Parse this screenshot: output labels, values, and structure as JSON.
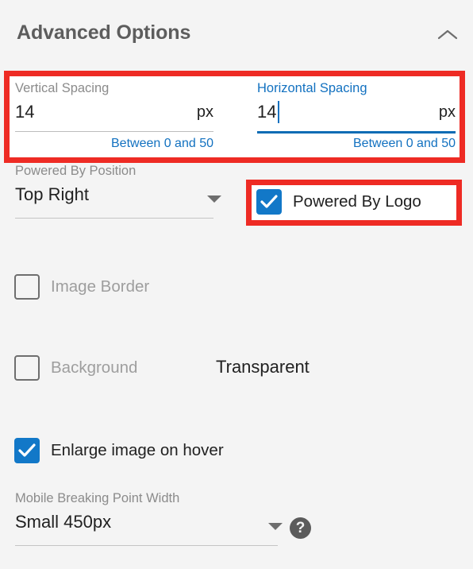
{
  "panel": {
    "title": "Advanced Options",
    "collapse_icon": "chevron-up-icon",
    "background_color": "#f4f4f4",
    "accent_color": "#1278c8",
    "annotation_color": "#ee2b24",
    "label_color": "#8b8b8b"
  },
  "spacing": {
    "vertical": {
      "label": "Vertical Spacing",
      "value": "14",
      "suffix": "px",
      "hint": "Between 0 and 50",
      "focused": false
    },
    "horizontal": {
      "label": "Horizontal Spacing",
      "value": "14",
      "suffix": "px",
      "hint": "Between 0 and 50",
      "focused": true
    }
  },
  "powered_by_position": {
    "label": "Powered By Position",
    "value": "Top Right",
    "arrow_icon": "chevron-down-icon"
  },
  "powered_by_logo": {
    "label": "Powered By Logo",
    "checked": true
  },
  "image_border": {
    "label": "Image Border",
    "checked": false,
    "disabled": true
  },
  "background": {
    "label": "Background",
    "checked": false,
    "disabled": true,
    "value": "Transparent"
  },
  "enlarge_on_hover": {
    "label": "Enlarge image on hover",
    "checked": true
  },
  "mobile_breaking_point": {
    "label": "Mobile Breaking Point Width",
    "value": "Small 450px",
    "arrow_icon": "chevron-down-icon",
    "help_icon": "question-mark-icon",
    "help_glyph": "?"
  }
}
